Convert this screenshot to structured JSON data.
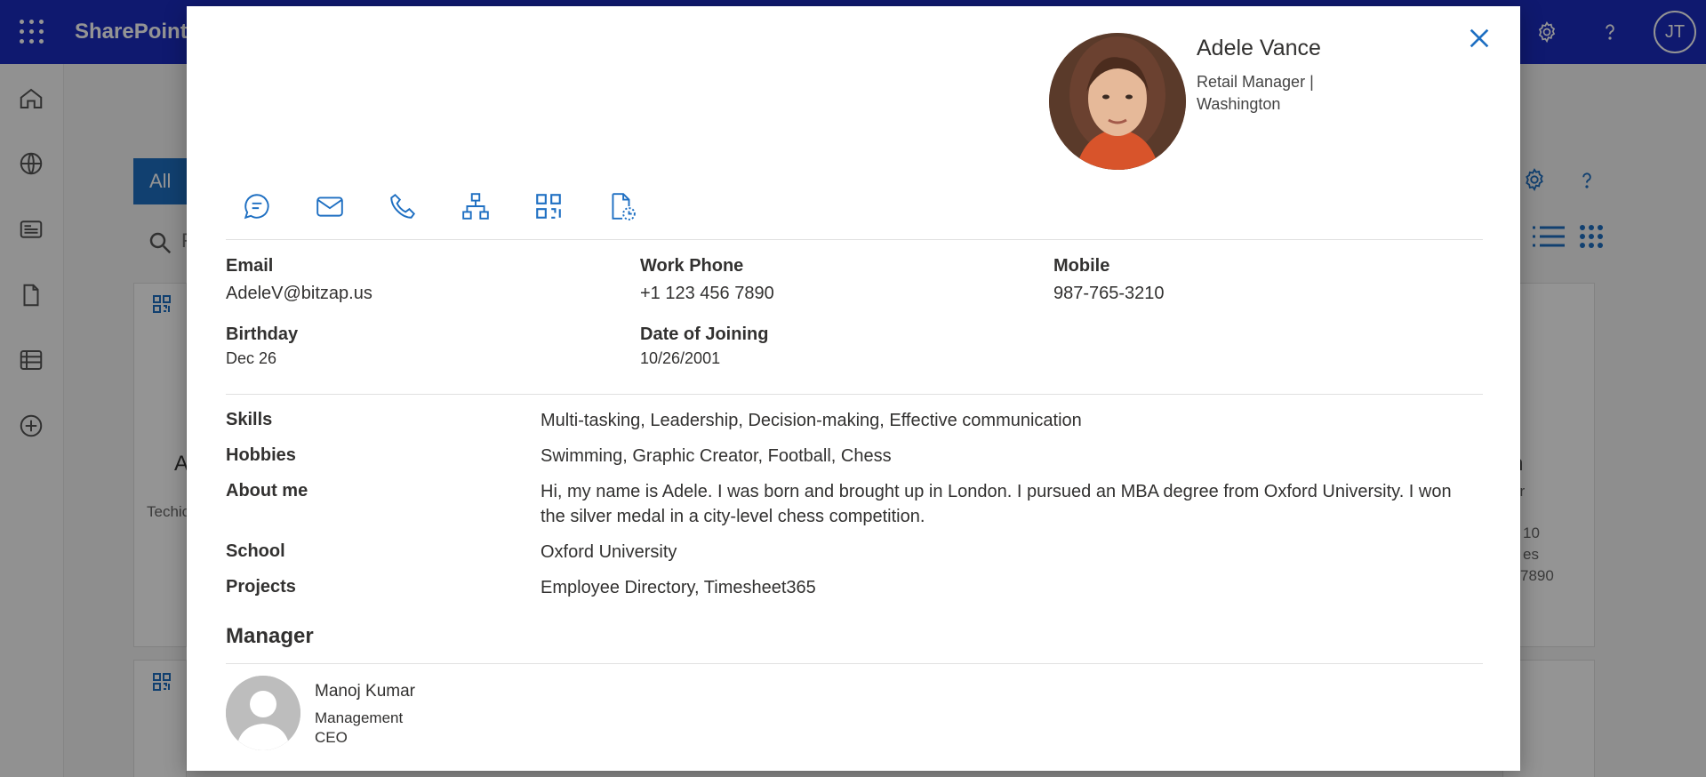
{
  "app": {
    "brand": "SharePoint",
    "user_initials": "JT"
  },
  "background": {
    "tab_all": "All",
    "search_placeholder": "F",
    "card_left_name_fragment": "A",
    "card_left_subtitle_fragment": "Techic",
    "card_right_name_fragment": "n",
    "card_right_subtitle_fragment": "or",
    "card_right_line1_fragment": "10",
    "card_right_line2_fragment": "es",
    "card_right_line3_fragment": "7890"
  },
  "profile": {
    "name": "Adele Vance",
    "title": "Retail Manager | Washington",
    "fields": {
      "email_label": "Email",
      "email_value": "AdeleV@bitzap.us",
      "work_phone_label": "Work Phone",
      "work_phone_value": "+1 123 456 7890",
      "mobile_label": "Mobile",
      "mobile_value": "987-765-3210",
      "birthday_label": "Birthday",
      "birthday_value": "Dec 26",
      "doj_label": "Date of Joining",
      "doj_value": "10/26/2001"
    },
    "details": {
      "skills_label": "Skills",
      "skills_value": "Multi-tasking, Leadership, Decision-making, Effective communication",
      "hobbies_label": "Hobbies",
      "hobbies_value": "Swimming, Graphic Creator, Football, Chess",
      "about_label": "About me",
      "about_value": "Hi, my name is Adele. I was born and brought up in London. I pursued an MBA degree from Oxford University. I won the silver medal in a city-level chess competition.",
      "school_label": "School",
      "school_value": "Oxford University",
      "projects_label": "Projects",
      "projects_value": "Employee Directory, Timesheet365"
    },
    "manager": {
      "section_title": "Manager",
      "name": "Manoj Kumar",
      "department": "Management",
      "role": "CEO"
    }
  },
  "icons": {
    "actions": [
      "chat-icon",
      "mail-icon",
      "phone-icon",
      "org-chart-icon",
      "qr-code-icon",
      "timesheet-icon"
    ]
  }
}
